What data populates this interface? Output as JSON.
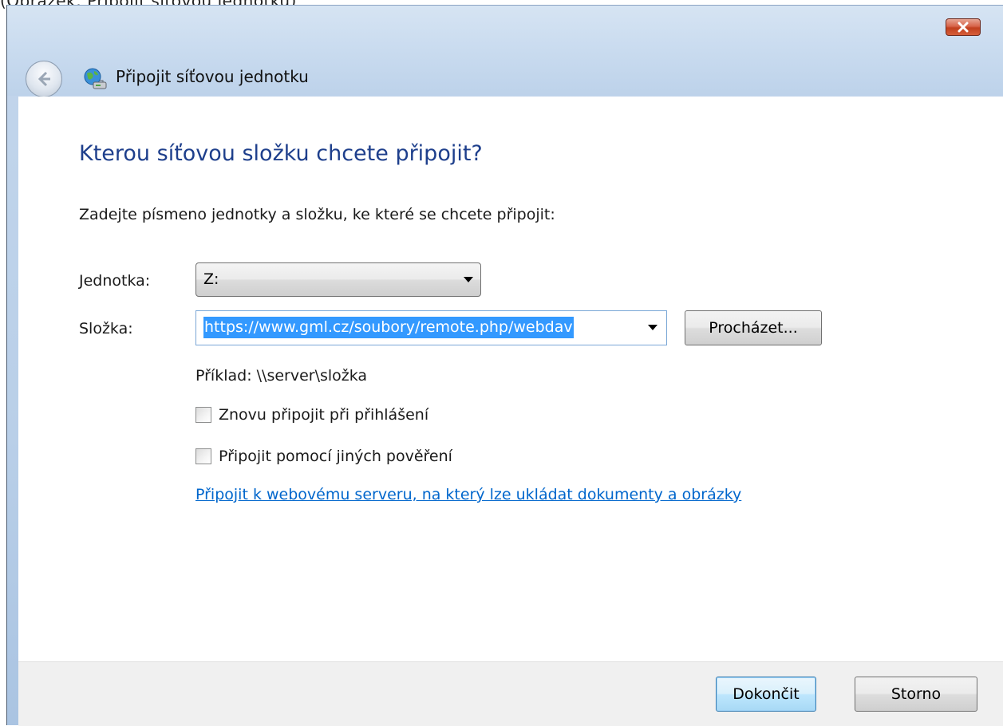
{
  "top_strip_text": "(Obrázek: Připojit síťovou jednotku)",
  "window": {
    "title": "Připojit síťovou jednotku"
  },
  "icons": {
    "close": "close-icon",
    "back": "back-arrow-icon",
    "network_drive": "network-drive-icon"
  },
  "content": {
    "heading": "Kterou síťovou složku chcete připojit?",
    "instruction": "Zadejte písmeno jednotky a složku, ke které se chcete připojit:",
    "drive_label": "Jednotka:",
    "drive_value": "Z:",
    "folder_label": "Složka:",
    "folder_value": "https://www.gml.cz/soubory/remote.php/webdav",
    "browse_label": "Procházet...",
    "example_text": "Příklad: \\\\server\\složka",
    "reconnect_label": "Znovu připojit při přihlášení",
    "reconnect_checked": false,
    "credentials_label": "Připojit pomocí jiných pověření",
    "credentials_checked": false,
    "web_server_link": "Připojit k webovému serveru, na který lze ukládat dokumenty a obrázky"
  },
  "footer": {
    "finish_label": "Dokončit",
    "cancel_label": "Storno"
  },
  "colors": {
    "heading": "#1e3f8c",
    "link": "#0066cc",
    "selection": "#3399ff",
    "close_button": "#c1401f"
  }
}
